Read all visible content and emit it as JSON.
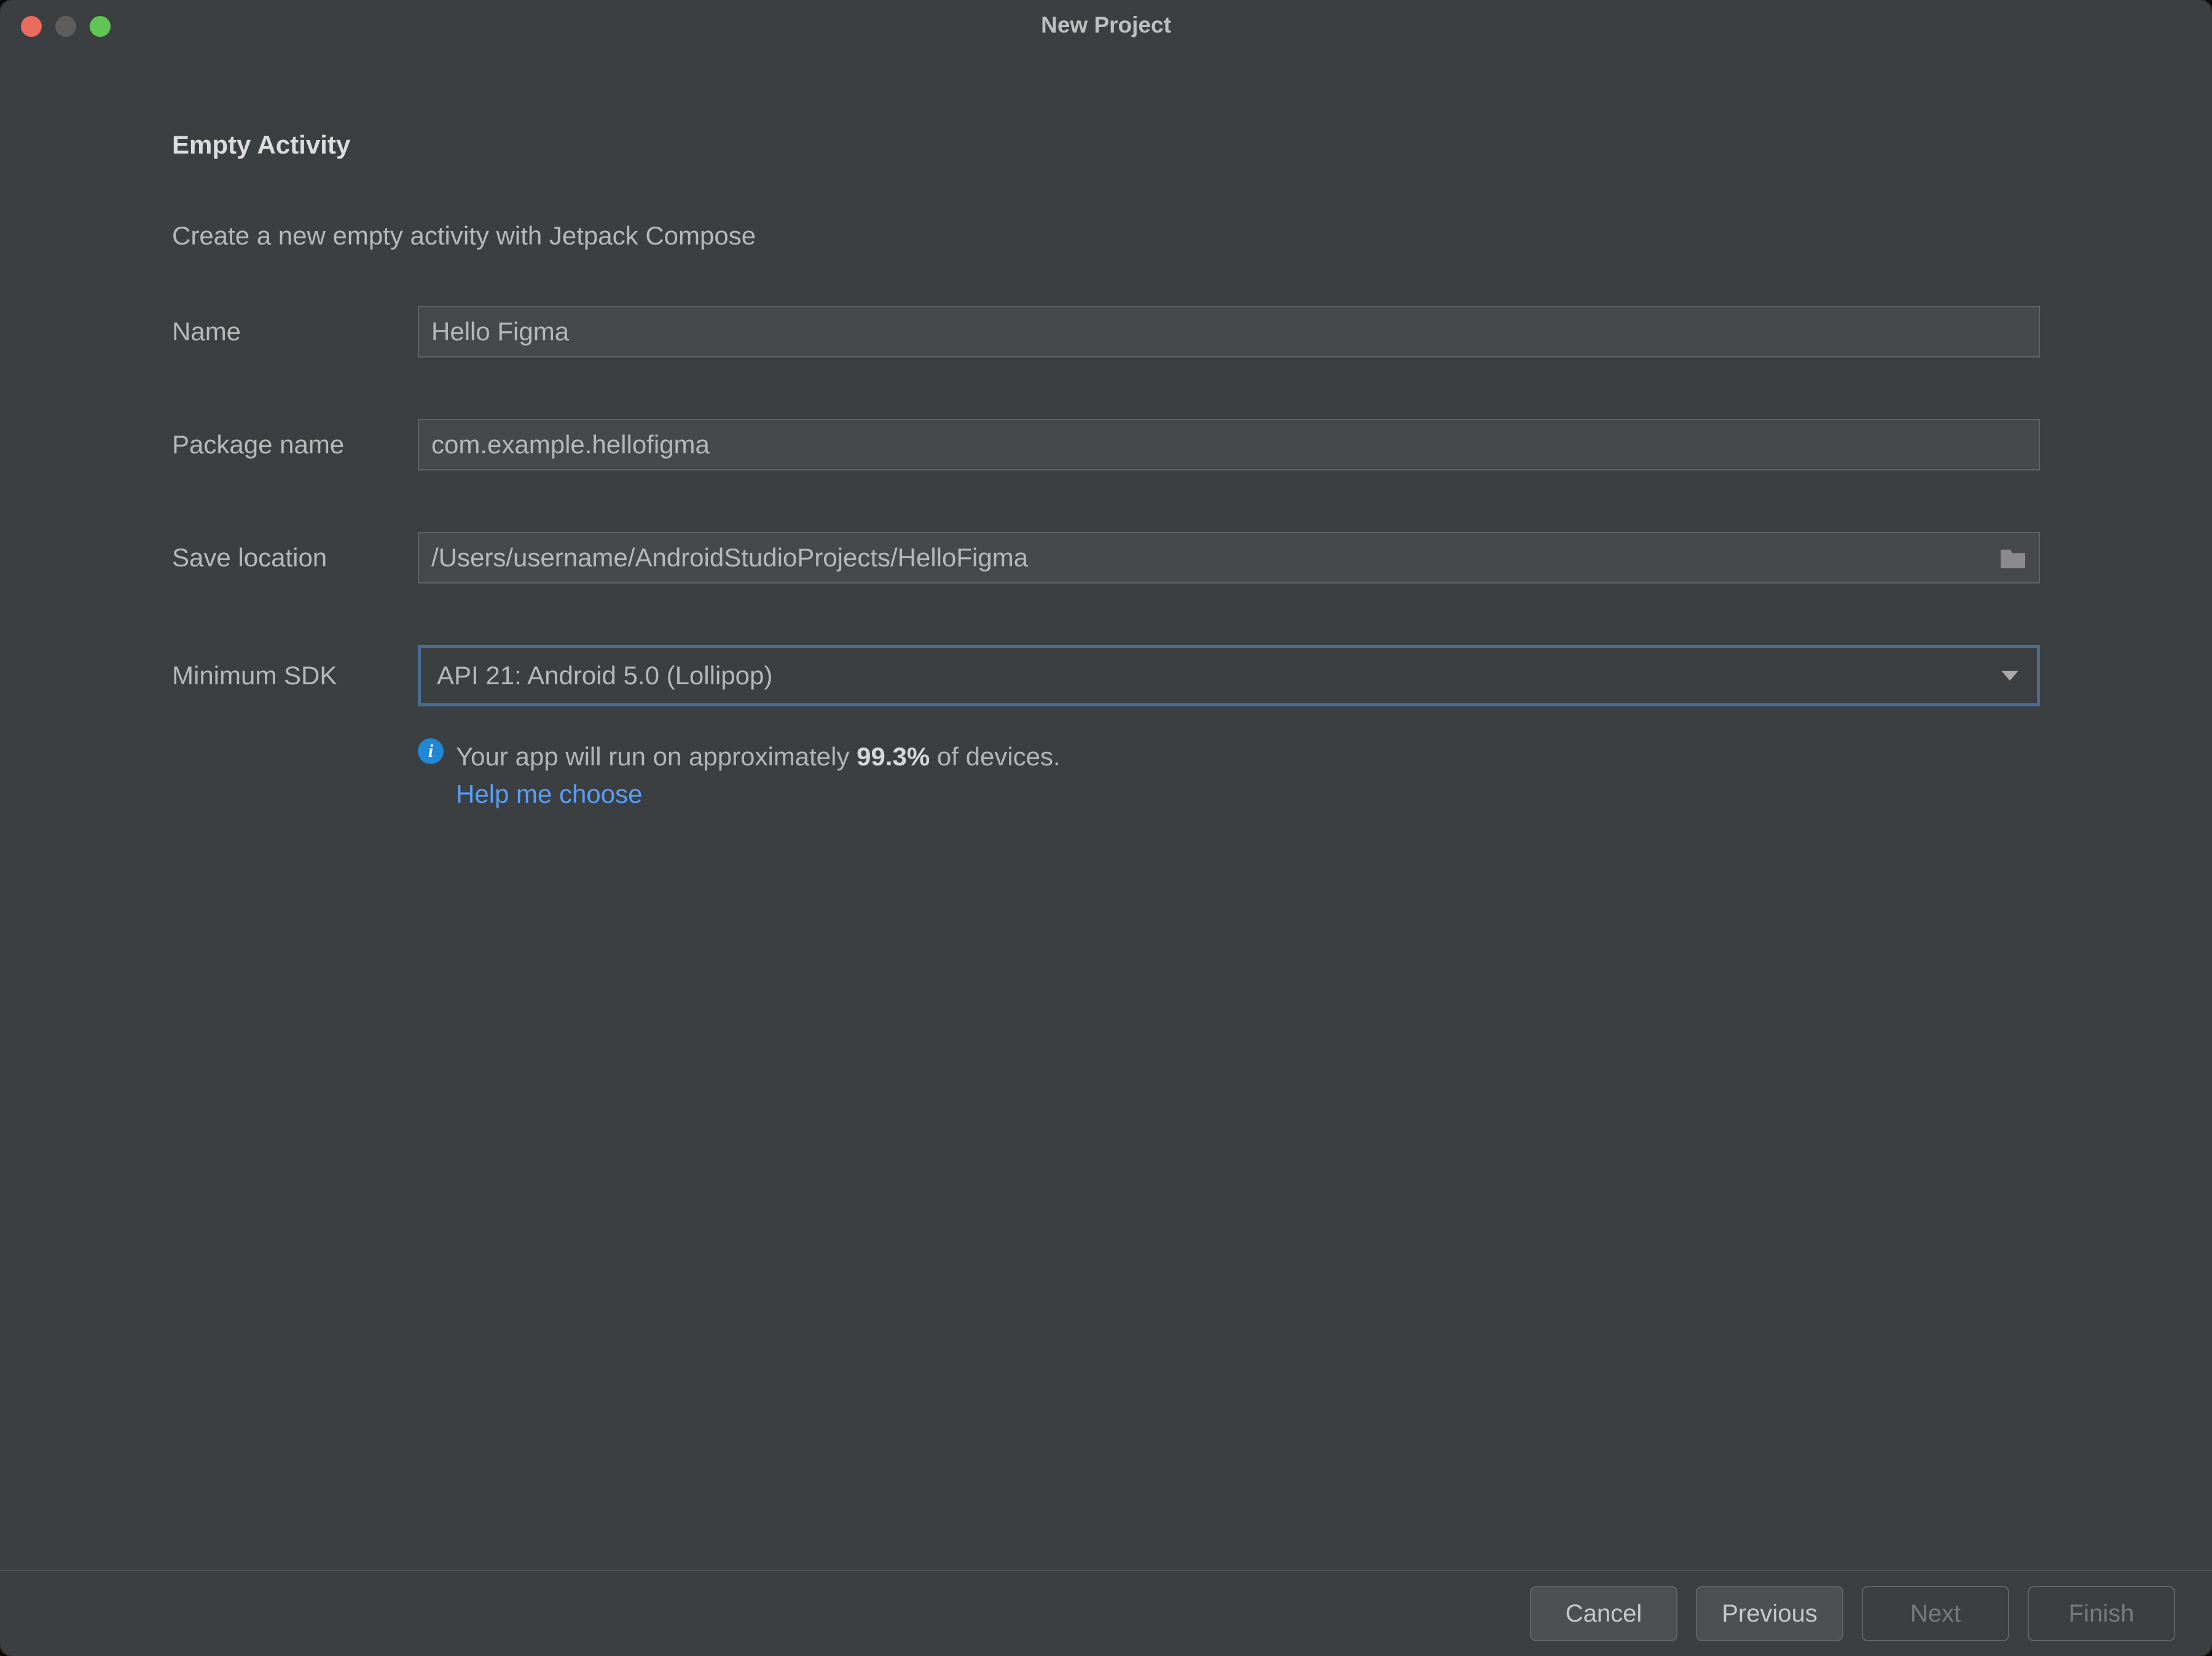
{
  "window": {
    "title": "New Project"
  },
  "form": {
    "heading": "Empty Activity",
    "subheading": "Create a new empty activity with Jetpack Compose",
    "name_label": "Name",
    "name_value": "Hello Figma",
    "package_label": "Package name",
    "package_value": "com.example.hellofigma",
    "location_label": "Save location",
    "location_value": "/Users/username/AndroidStudioProjects/HelloFigma",
    "sdk_label": "Minimum SDK",
    "sdk_value": "API 21: Android 5.0 (Lollipop)",
    "info_prefix": "Your app will run on approximately ",
    "info_percent": "99.3%",
    "info_suffix": " of devices.",
    "help_link": "Help me choose"
  },
  "footer": {
    "cancel": "Cancel",
    "previous": "Previous",
    "next": "Next",
    "finish": "Finish"
  }
}
